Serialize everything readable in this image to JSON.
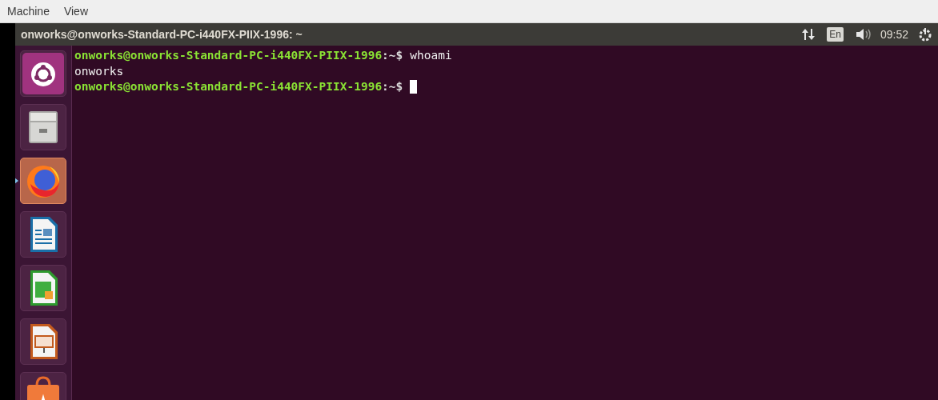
{
  "menu_bar": {
    "items": [
      "Machine",
      "View"
    ]
  },
  "top_panel": {
    "title": "onworks@onworks-Standard-PC-i440FX-PIIX-1996: ~",
    "keyboard_layout": "En",
    "time": "09:52"
  },
  "launcher": {
    "items": [
      {
        "kind": "ubuntu",
        "selected": false
      },
      {
        "kind": "files",
        "selected": false
      },
      {
        "kind": "firefox",
        "selected": true
      },
      {
        "kind": "writer",
        "selected": false
      },
      {
        "kind": "calc",
        "selected": false
      },
      {
        "kind": "impress",
        "selected": false
      },
      {
        "kind": "software",
        "selected": false
      }
    ]
  },
  "terminal": {
    "lines": [
      {
        "kind": "prompt",
        "user_host": "onworks@onworks-Standard-PC-i440FX-PIIX-1996",
        "path": ":~$",
        "command": "whoami"
      },
      {
        "kind": "output",
        "text": "onworks"
      },
      {
        "kind": "prompt",
        "user_host": "onworks@onworks-Standard-PC-i440FX-PIIX-1996",
        "path": ":~$",
        "cursor": true
      }
    ]
  }
}
